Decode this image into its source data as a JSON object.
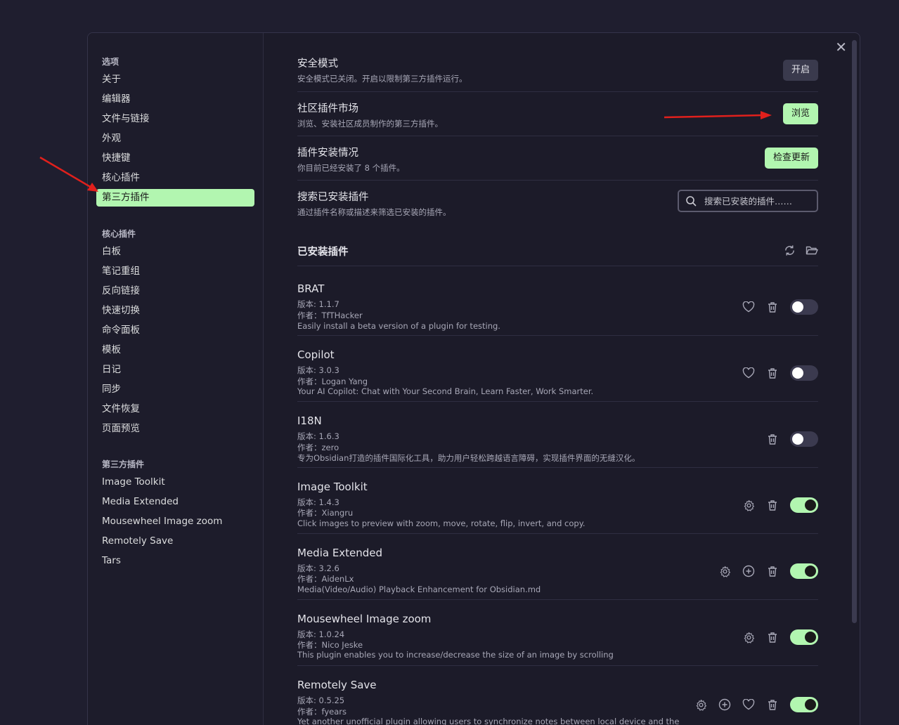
{
  "sidebar": {
    "options_heading": "选项",
    "options": [
      "关于",
      "编辑器",
      "文件与链接",
      "外观",
      "快捷键",
      "核心插件",
      "第三方插件"
    ],
    "core_heading": "核心插件",
    "core": [
      "白板",
      "笔记重组",
      "反向链接",
      "快速切换",
      "命令面板",
      "模板",
      "日记",
      "同步",
      "文件恢复",
      "页面预览"
    ],
    "community_heading": "第三方插件",
    "community": [
      "Image Toolkit",
      "Media Extended",
      "Mousewheel Image zoom",
      "Remotely Save",
      "Tars"
    ]
  },
  "settings": {
    "safe_mode": {
      "name": "安全模式",
      "desc": "安全模式已关闭。开启以限制第三方插件运行。",
      "button": "开启"
    },
    "market": {
      "name": "社区插件市场",
      "desc": "浏览、安装社区成员制作的第三方插件。",
      "button": "浏览"
    },
    "installed_status": {
      "name": "插件安装情况",
      "desc": "你目前已经安装了 8 个插件。",
      "button": "检查更新"
    },
    "search": {
      "name": "搜索已安装插件",
      "desc": "通过插件名称或描述来筛选已安装的插件。",
      "placeholder": "搜索已安装的插件……"
    }
  },
  "installed_heading": "已安装插件",
  "plugins": [
    {
      "name": "BRAT",
      "version": "版本: 1.1.7",
      "author": "作者：TfTHacker",
      "desc": "Easily install a beta version of a plugin for testing.",
      "enabled": false
    },
    {
      "name": "Copilot",
      "version": "版本: 3.0.3",
      "author": "作者：Logan Yang",
      "desc": "Your AI Copilot: Chat with Your Second Brain, Learn Faster, Work Smarter.",
      "enabled": false
    },
    {
      "name": "I18N",
      "version": "版本: 1.6.3",
      "author": "作者：zero",
      "desc": "专为Obsidian打造的插件国际化工具，助力用户轻松跨越语言障碍，实现插件界面的无缝汉化。",
      "enabled": false
    },
    {
      "name": "Image Toolkit",
      "version": "版本: 1.4.3",
      "author": "作者：Xiangru",
      "desc": "Click images to preview with zoom, move, rotate, flip, invert, and copy.",
      "enabled": true
    },
    {
      "name": "Media Extended",
      "version": "版本: 3.2.6",
      "author": "作者：AidenLx",
      "desc": "Media(Video/Audio) Playback Enhancement for Obsidian.md",
      "enabled": true
    },
    {
      "name": "Mousewheel Image zoom",
      "version": "版本: 1.0.24",
      "author": "作者：Nico Jeske",
      "desc": "This plugin enables you to increase/decrease the size of an image by scrolling",
      "enabled": true
    },
    {
      "name": "Remotely Save",
      "version": "版本: 0.5.25",
      "author": "作者：fyears",
      "desc": "Yet another unofficial plugin allowing users to synchronize notes between local device and the",
      "enabled": true
    }
  ],
  "colors": {
    "accent": "#b2f6b0",
    "background": "#1c1b29",
    "annotation_arrow": "#e0201c"
  }
}
